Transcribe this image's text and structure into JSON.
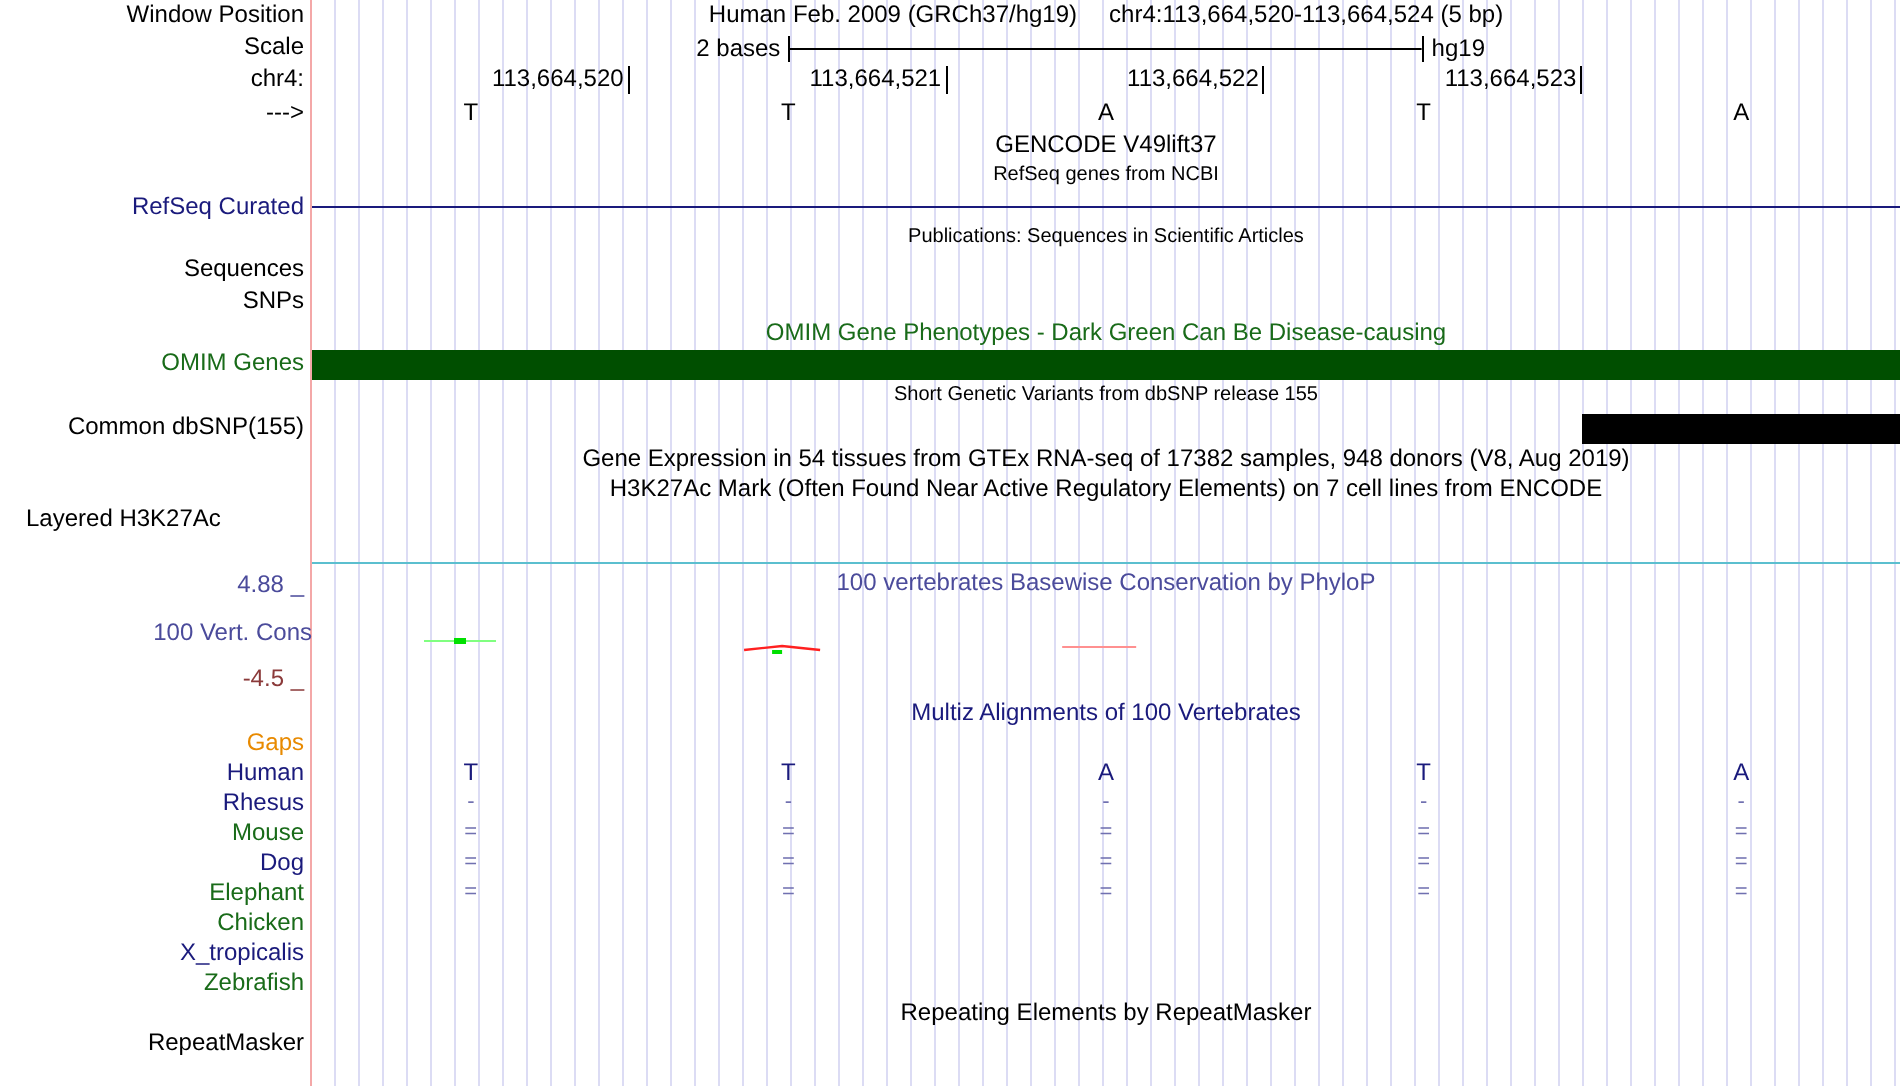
{
  "header": {
    "label": "Window Position",
    "assembly": "Human Feb. 2009 (GRCh37/hg19)",
    "position": "chr4:113,664,520-113,664,524 (5 bp)"
  },
  "scale": {
    "label": "Scale",
    "text": "2 bases",
    "assembly": "hg19"
  },
  "ruler": {
    "label": "chr4:",
    "ticks": [
      "113,664,520",
      "113,664,521",
      "113,664,522",
      "113,664,523"
    ]
  },
  "sequence": {
    "label": "--->",
    "bases": [
      "T",
      "T",
      "A",
      "T",
      "A"
    ]
  },
  "rows": [
    {
      "kind": "title",
      "text": "GENCODE V49lift37",
      "color": "#000000"
    },
    {
      "kind": "note",
      "text": "RefSeq genes from NCBI"
    },
    {
      "kind": "line",
      "label": "RefSeq Curated",
      "color": "#1a1a7c"
    },
    {
      "kind": "note",
      "text": "Publications: Sequences in Scientific Articles"
    },
    {
      "kind": "label",
      "label": "Sequences",
      "color": "#000000"
    },
    {
      "kind": "label",
      "label": "SNPs",
      "color": "#000000"
    },
    {
      "kind": "title",
      "text": "OMIM Gene Phenotypes - Dark Green Can Be Disease-causing",
      "color": "#196b19"
    },
    {
      "kind": "bar",
      "label": "OMIM Genes",
      "color": "#196b19",
      "feature": {
        "color": "#004f00",
        "covers": [
          true,
          true,
          true,
          true,
          true
        ]
      }
    },
    {
      "kind": "note",
      "text": "Short Genetic Variants from dbSNP release 155"
    },
    {
      "kind": "bar",
      "label": "Common dbSNP(155)",
      "color": "#000000",
      "feature": {
        "color": "#000000",
        "covers": [
          false,
          false,
          false,
          false,
          true
        ]
      }
    },
    {
      "kind": "title",
      "text": "Gene Expression in 54 tissues from GTEx RNA-seq of 17382 samples, 948 donors (V8, Aug 2019)",
      "color": "#000000"
    },
    {
      "kind": "title",
      "text": "H3K27Ac Mark (Often Found Near Active Regulatory Elements) on 7 cell lines from ENCODE",
      "color": "#000000"
    },
    {
      "kind": "side_label",
      "label": "Layered H3K27Ac",
      "color": "#000000"
    },
    {
      "kind": "divider"
    },
    {
      "kind": "conservation",
      "title": "100 vertebrates Basewise Conservation by PhyloP",
      "label": "100 Vert. Cons",
      "max": "4.88 _",
      "min": "-4.5 _",
      "color": "#4b4b9b"
    },
    {
      "kind": "title",
      "text": "Multiz Alignments of 100 Vertebrates",
      "color": "#1a1a7c"
    },
    {
      "kind": "species",
      "label": "Gaps",
      "color": "#e88a00",
      "cells": []
    },
    {
      "kind": "reference",
      "label": "Human",
      "color": "#1a1a7c",
      "cells": [
        "T",
        "T",
        "A",
        "T",
        "A"
      ]
    },
    {
      "kind": "species",
      "label": "Rhesus",
      "color": "#1a1a7c",
      "cells": [
        "-",
        "-",
        "-",
        "-",
        "-"
      ]
    },
    {
      "kind": "species",
      "label": "Mouse",
      "color": "#196b19",
      "cells": [
        "=",
        "=",
        "=",
        "=",
        "="
      ]
    },
    {
      "kind": "species",
      "label": "Dog",
      "color": "#1a1a7c",
      "cells": [
        "=",
        "=",
        "=",
        "=",
        "="
      ]
    },
    {
      "kind": "species",
      "label": "Elephant",
      "color": "#196b19",
      "cells": [
        "=",
        "=",
        "=",
        "=",
        "="
      ]
    },
    {
      "kind": "species",
      "label": "Chicken",
      "color": "#196b19",
      "cells": []
    },
    {
      "kind": "species",
      "label": "X_tropicalis",
      "color": "#1a1a7c",
      "cells": []
    },
    {
      "kind": "species",
      "label": "Zebrafish",
      "color": "#196b19",
      "cells": []
    },
    {
      "kind": "title",
      "text": "Repeating Elements by RepeatMasker",
      "color": "#000000"
    },
    {
      "kind": "label",
      "label": "RepeatMasker",
      "color": "#000000"
    }
  ]
}
